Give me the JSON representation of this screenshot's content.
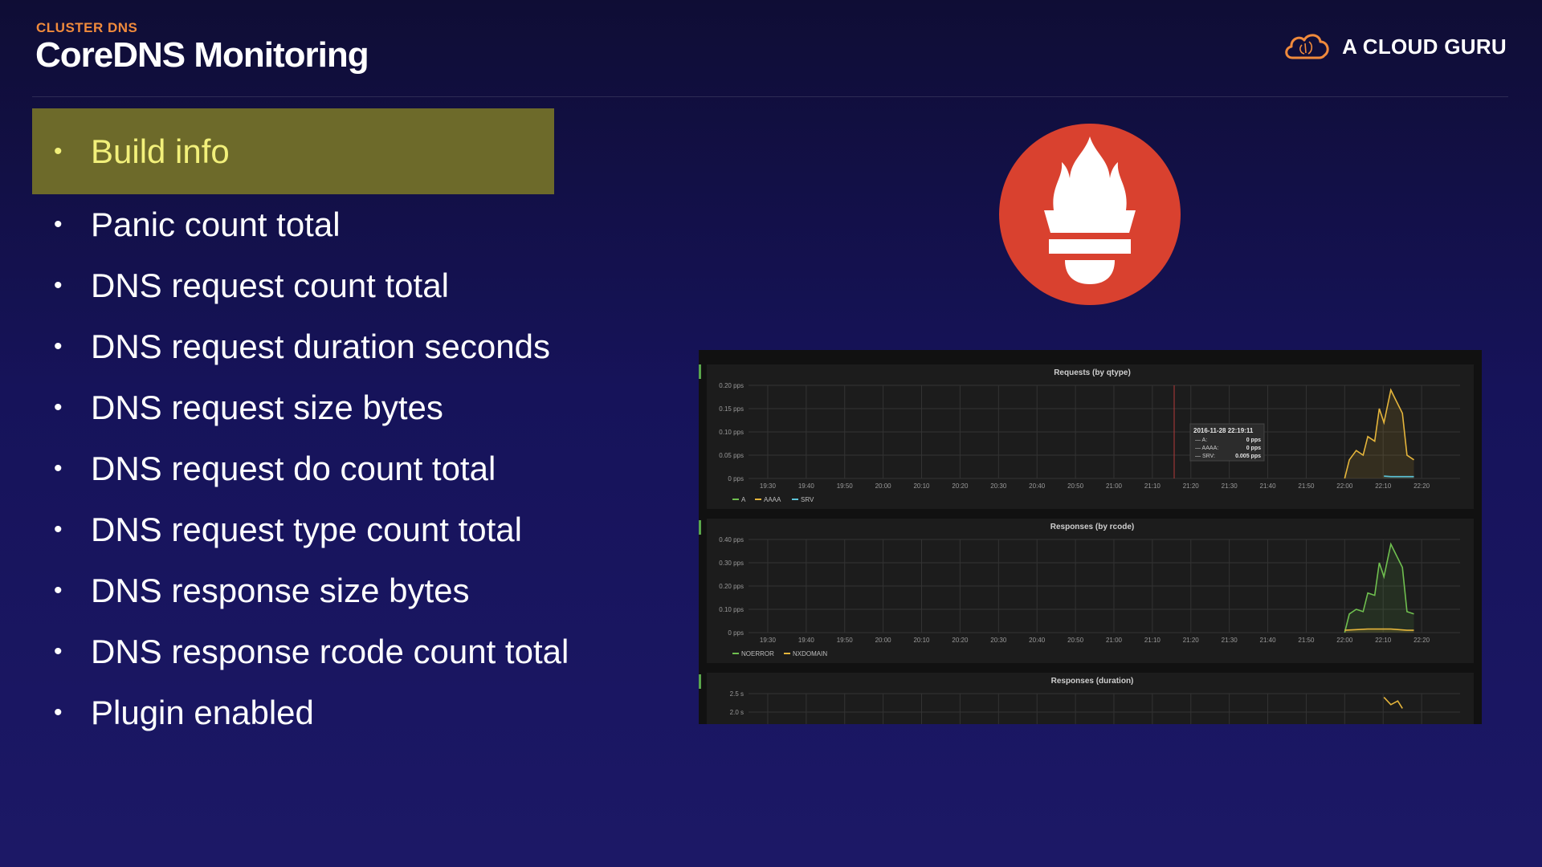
{
  "header": {
    "eyebrow": "CLUSTER DNS",
    "title": "CoreDNS Monitoring",
    "brand": "A CLOUD GURU",
    "brand_icon": "cloud-brain-icon"
  },
  "colors": {
    "accent_orange": "#f08a3c",
    "highlight_bg": "#6d6a2a",
    "highlight_text": "#f2f07a",
    "prometheus_red": "#d9412f",
    "series_green": "#6fbf4f",
    "series_yellow": "#e5b53b",
    "series_cyan": "#5bc2d6"
  },
  "bullets": [
    {
      "label": "Build info",
      "highlighted": true
    },
    {
      "label": "Panic count total"
    },
    {
      "label": "DNS request count total"
    },
    {
      "label": "DNS request duration seconds"
    },
    {
      "label": "DNS request size bytes"
    },
    {
      "label": "DNS request do count total"
    },
    {
      "label": "DNS request type count total"
    },
    {
      "label": "DNS response size bytes"
    },
    {
      "label": "DNS response rcode count total"
    },
    {
      "label": "Plugin enabled"
    }
  ],
  "logo": {
    "icon": "prometheus-torch-icon"
  },
  "chart_data": [
    {
      "type": "area",
      "title": "Requests (by qtype)",
      "x": [
        "19:30",
        "19:40",
        "19:50",
        "20:00",
        "20:10",
        "20:20",
        "20:30",
        "20:40",
        "20:50",
        "21:00",
        "21:10",
        "21:20",
        "21:30",
        "21:40",
        "21:50",
        "22:00",
        "22:10",
        "22:20"
      ],
      "y_ticks": [
        "0.20 pps",
        "0.15 pps",
        "0.10 pps",
        "0.05 pps",
        "0 pps"
      ],
      "ylim": [
        0,
        0.2
      ],
      "legend": [
        "A",
        "AAAA",
        "SRV"
      ],
      "legend_position": "bottom-left",
      "grid": true,
      "tooltip": {
        "time": "2016-11-28 22:19:11",
        "rows": [
          {
            "name": "A",
            "value": "0 pps"
          },
          {
            "name": "AAAA",
            "value": "0 pps"
          },
          {
            "name": "SRV",
            "value": "0.005 pps"
          }
        ]
      },
      "series": [
        {
          "name": "AAAA",
          "color": "#e5b53b",
          "points": [
            [
              22.0,
              0
            ],
            [
              22.02,
              0.04
            ],
            [
              22.05,
              0.06
            ],
            [
              22.08,
              0.05
            ],
            [
              22.1,
              0.09
            ],
            [
              22.13,
              0.08
            ],
            [
              22.15,
              0.15
            ],
            [
              22.17,
              0.12
            ],
            [
              22.2,
              0.19
            ],
            [
              22.22,
              0.17
            ],
            [
              22.25,
              0.14
            ],
            [
              22.27,
              0.05
            ],
            [
              22.3,
              0.04
            ]
          ]
        },
        {
          "name": "SRV",
          "color": "#5bc2d6",
          "points": [
            [
              22.17,
              0.005
            ],
            [
              22.2,
              0.004
            ],
            [
              22.25,
              0.004
            ],
            [
              22.3,
              0.004
            ]
          ]
        }
      ]
    },
    {
      "type": "area",
      "title": "Responses (by rcode)",
      "x": [
        "19:30",
        "19:40",
        "19:50",
        "20:00",
        "20:10",
        "20:20",
        "20:30",
        "20:40",
        "20:50",
        "21:00",
        "21:10",
        "21:20",
        "21:30",
        "21:40",
        "21:50",
        "22:00",
        "22:10",
        "22:20"
      ],
      "y_ticks": [
        "0.40 pps",
        "0.30 pps",
        "0.20 pps",
        "0.10 pps",
        "0 pps"
      ],
      "ylim": [
        0,
        0.4
      ],
      "legend": [
        "NOERROR",
        "NXDOMAIN"
      ],
      "legend_position": "bottom-left",
      "grid": true,
      "series": [
        {
          "name": "NOERROR",
          "color": "#6fbf4f",
          "points": [
            [
              22.0,
              0
            ],
            [
              22.02,
              0.08
            ],
            [
              22.05,
              0.1
            ],
            [
              22.08,
              0.09
            ],
            [
              22.1,
              0.17
            ],
            [
              22.13,
              0.16
            ],
            [
              22.15,
              0.3
            ],
            [
              22.17,
              0.24
            ],
            [
              22.2,
              0.38
            ],
            [
              22.22,
              0.34
            ],
            [
              22.25,
              0.28
            ],
            [
              22.27,
              0.09
            ],
            [
              22.3,
              0.08
            ]
          ]
        },
        {
          "name": "NXDOMAIN",
          "color": "#e5b53b",
          "points": [
            [
              22.0,
              0.01
            ],
            [
              22.1,
              0.015
            ],
            [
              22.2,
              0.015
            ],
            [
              22.27,
              0.01
            ],
            [
              22.3,
              0.01
            ]
          ]
        }
      ]
    },
    {
      "type": "line",
      "title": "Responses (duration)",
      "y_ticks": [
        "2.5 s",
        "2.0 s"
      ],
      "grid": true,
      "series": [
        {
          "name": "",
          "color": "#e5b53b",
          "points": [
            [
              22.17,
              2.4
            ],
            [
              22.2,
              2.2
            ],
            [
              22.23,
              2.3
            ],
            [
              22.25,
              2.1
            ]
          ]
        }
      ]
    }
  ]
}
